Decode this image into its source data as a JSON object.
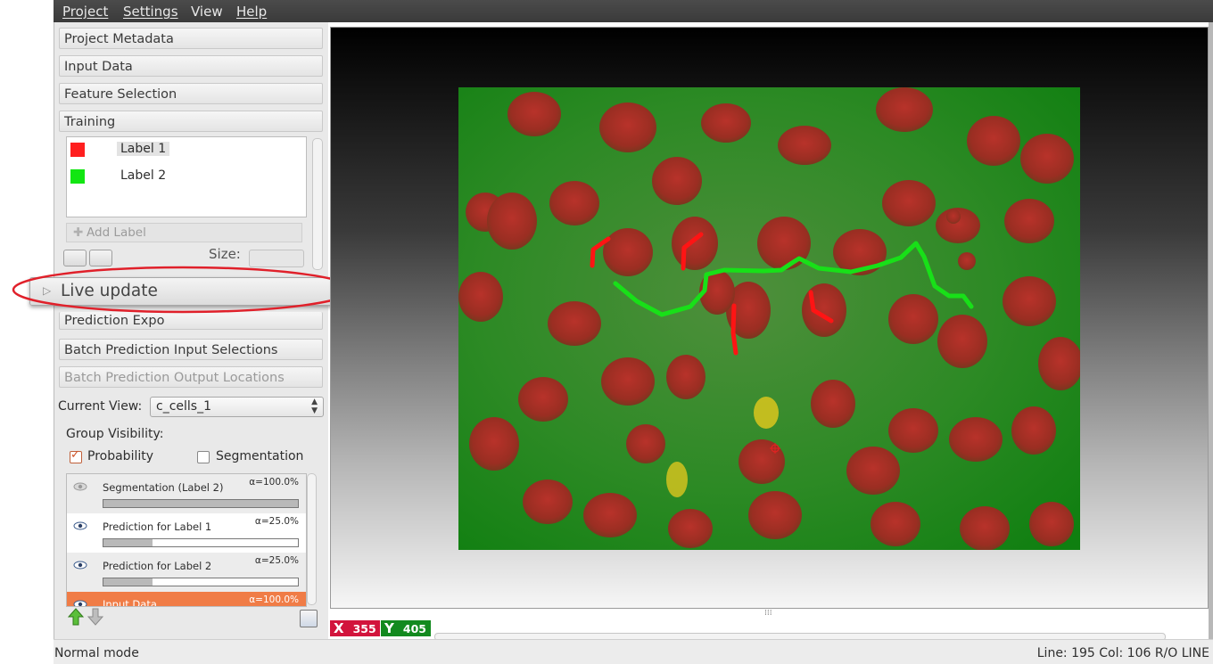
{
  "menubar": {
    "items": [
      "Project",
      "Settings",
      "View",
      "Help"
    ]
  },
  "left_panel": {
    "drawers_top": [
      "Project Metadata",
      "Input Data",
      "Feature Selection",
      "Training"
    ],
    "labels": [
      {
        "name": "Label 1",
        "color": "#ff1f1f",
        "selected": true
      },
      {
        "name": "Label 2",
        "color": "#12e612",
        "selected": false
      }
    ],
    "add_label": "Add Label",
    "size_label": "Size:",
    "live_update": "Live update",
    "prediction_export_partial": "Prediction Expo",
    "drawers_bottom": [
      "Batch Prediction Input Selections",
      "Batch Prediction Output Locations"
    ],
    "current_view_label": "Current View:",
    "current_view_value": "c_cells_1",
    "group_visibility_label": "Group Visibility:",
    "group_probability": {
      "label": "Probability",
      "checked": true
    },
    "group_segmentation": {
      "label": "Segmentation",
      "checked": false
    },
    "layers": [
      {
        "name": "Segmentation (Label 2)",
        "alpha": "α=100.0%",
        "opacity": 1.0
      },
      {
        "name": "Prediction for Label 1",
        "alpha": "α=25.0%",
        "opacity": 0.25
      },
      {
        "name": "Prediction for Label 2",
        "alpha": "α=25.0%",
        "opacity": 0.25
      },
      {
        "name": "Input Data",
        "alpha": "α=100.0%",
        "opacity": 1.0
      }
    ]
  },
  "viewer": {
    "x_label": "X",
    "x_value": "355",
    "y_label": "Y",
    "y_value": "405",
    "x_color": "#d2143c",
    "y_color": "#138a1f"
  },
  "status": {
    "mode": "Normal mode",
    "position": "Line: 195 Col: 106 R/O LINE"
  },
  "colors": {
    "accent": "#f07c46",
    "callout_ring": "#e0202a"
  }
}
